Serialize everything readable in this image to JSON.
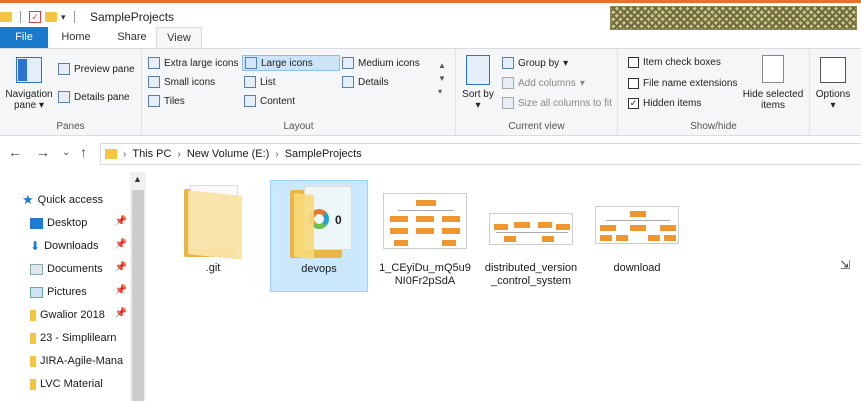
{
  "window": {
    "title": "SampleProjects",
    "accent": "#e9702a"
  },
  "tabs": [
    {
      "label": "File"
    },
    {
      "label": "Home"
    },
    {
      "label": "Share"
    },
    {
      "label": "View"
    }
  ],
  "ribbon": {
    "panes": {
      "label": "Panes",
      "navigation_pane": "Navigation pane",
      "preview_pane": "Preview pane",
      "details_pane": "Details pane"
    },
    "layout": {
      "label": "Layout",
      "extra_large_icons": "Extra large icons",
      "large_icons": "Large icons",
      "medium_icons": "Medium icons",
      "small_icons": "Small icons",
      "list": "List",
      "details": "Details",
      "tiles": "Tiles",
      "content": "Content"
    },
    "current_view": {
      "label": "Current view",
      "sort_by": "Sort by",
      "group_by": "Group by",
      "add_columns": "Add columns",
      "size_all_columns": "Size all columns to fit"
    },
    "show_hide": {
      "label": "Show/hide",
      "item_check_boxes": "Item check boxes",
      "file_name_extensions": "File name extensions",
      "hidden_items": "Hidden items",
      "hide_selected_items": "Hide selected items",
      "options": "Options"
    }
  },
  "address": {
    "crumbs": [
      "This PC",
      "New Volume (E:)",
      "SampleProjects"
    ]
  },
  "nav_pane": {
    "items": [
      {
        "label": "Quick access",
        "icon": "star-icon"
      },
      {
        "label": "Desktop",
        "icon": "desktop-icon"
      },
      {
        "label": "Downloads",
        "icon": "download-icon"
      },
      {
        "label": "Documents",
        "icon": "documents-icon"
      },
      {
        "label": "Pictures",
        "icon": "pictures-icon"
      },
      {
        "label": "Gwalior 2018",
        "icon": "folder-icon"
      },
      {
        "label": "23 - Simplilearn",
        "icon": "folder-icon"
      },
      {
        "label": "JIRA-Agile-Mana",
        "icon": "folder-icon"
      },
      {
        "label": "LVC Material",
        "icon": "folder-icon"
      }
    ]
  },
  "files": [
    {
      "name": ".git",
      "type": "folder"
    },
    {
      "name": "devops",
      "type": "folder",
      "selected": true
    },
    {
      "name": "1_CEyiDu_mQ5u9NI0Fr2pSdA",
      "type": "image"
    },
    {
      "name": "distributed_version_control_system",
      "type": "image"
    },
    {
      "name": "download",
      "type": "image"
    }
  ]
}
